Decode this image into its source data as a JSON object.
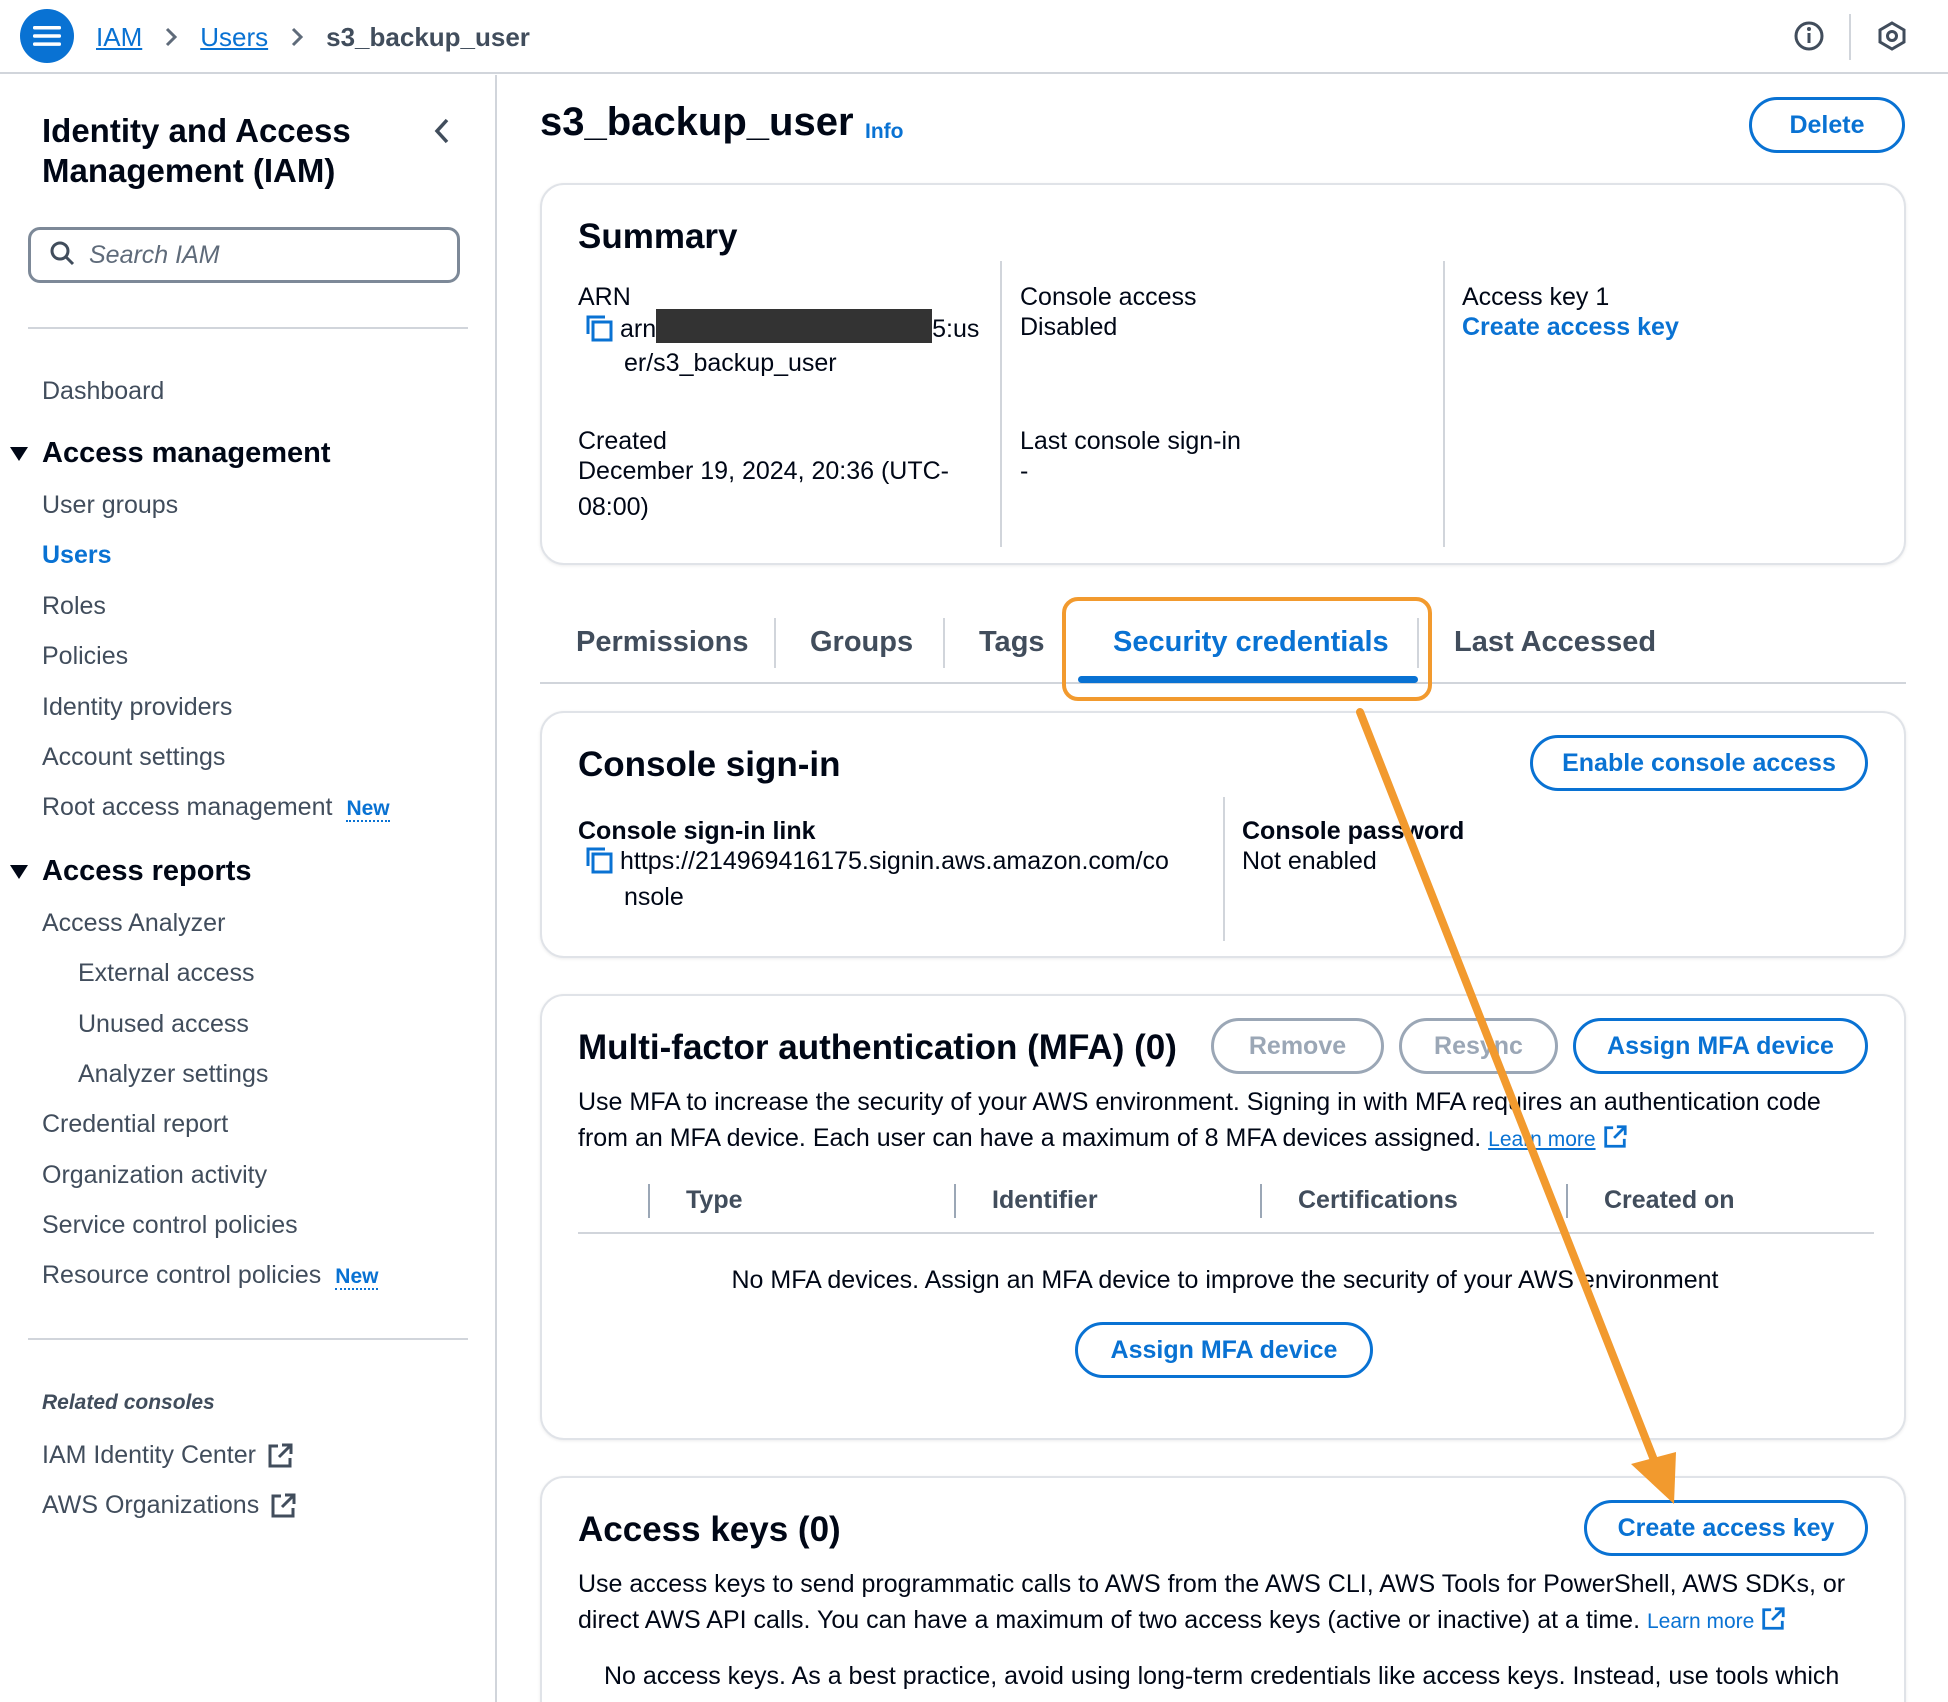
{
  "breadcrumb": {
    "items": [
      "IAM",
      "Users"
    ],
    "current": "s3_backup_user"
  },
  "header_icons": [
    "info-icon",
    "settings-hex-icon"
  ],
  "sidebar": {
    "title": "Identity and Access Management (IAM)",
    "search_placeholder": "Search IAM",
    "dashboard": "Dashboard",
    "access_management": {
      "label": "Access management",
      "items": [
        "User groups",
        "Users",
        "Roles",
        "Policies",
        "Identity providers",
        "Account settings",
        "Root access management"
      ],
      "active": "Users",
      "new_badge": "New"
    },
    "access_reports": {
      "label": "Access reports",
      "analyzer": "Access Analyzer",
      "analyzer_items": [
        "External access",
        "Unused access",
        "Analyzer settings"
      ],
      "items": [
        "Credential report",
        "Organization activity",
        "Service control policies",
        "Resource control policies"
      ],
      "new_badge": "New"
    },
    "related_consoles": {
      "title": "Related consoles",
      "items": [
        "IAM Identity Center",
        "AWS Organizations"
      ]
    }
  },
  "page": {
    "title": "s3_backup_user",
    "info": "Info",
    "delete_label": "Delete"
  },
  "summary": {
    "title": "Summary",
    "arn_label": "ARN",
    "arn_prefix": "arn",
    "arn_suffix": "5:us",
    "arn_line2": "er/s3_backup_user",
    "created_label": "Created",
    "created_line1": "December 19, 2024, 20:36 (UTC-",
    "created_line2": "08:00)",
    "console_access_label": "Console access",
    "console_access_value": "Disabled",
    "last_signin_label": "Last console sign-in",
    "last_signin_value": "-",
    "access_key_label": "Access key 1",
    "access_key_link": "Create access key"
  },
  "tabs": {
    "items": [
      "Permissions",
      "Groups",
      "Tags",
      "Security credentials",
      "Last Accessed"
    ],
    "active": "Security credentials"
  },
  "console_signin": {
    "title": "Console sign-in",
    "enable_label": "Enable console access",
    "link_label": "Console sign-in link",
    "link_line1": "https://214969416175.signin.aws.amazon.com/co",
    "link_line2": "nsole",
    "password_label": "Console password",
    "password_value": "Not enabled"
  },
  "mfa": {
    "title": "Multi-factor authentication (MFA) (0)",
    "remove_label": "Remove",
    "resync_label": "Resync",
    "assign_label": "Assign MFA device",
    "desc_line1": "Use MFA to increase the security of your AWS environment. Signing in with MFA requires an authentication code",
    "desc_line2": "from an MFA device. Each user can have a maximum of 8 MFA devices assigned.",
    "learn_more": "Learn more",
    "columns": [
      "Type",
      "Identifier",
      "Certifications",
      "Created on"
    ],
    "empty_text": "No MFA devices. Assign an MFA device to improve the security of your AWS environment",
    "empty_assign_label": "Assign MFA device"
  },
  "access_keys": {
    "title": "Access keys (0)",
    "create_label": "Create access key",
    "desc_line1": "Use access keys to send programmatic calls to AWS from the AWS CLI, AWS Tools for PowerShell, AWS SDKs, or",
    "desc_line2": "direct AWS API calls. You can have a maximum of two access keys (active or inactive) at a time.",
    "learn_more": "Learn more",
    "empty_text": "No access keys. As a best practice, avoid using long-term credentials like access keys. Instead, use tools which"
  },
  "colors": {
    "accent": "#0972d3",
    "annotation": "#f29a2e",
    "text": "#000716",
    "muted": "#414d5c"
  }
}
